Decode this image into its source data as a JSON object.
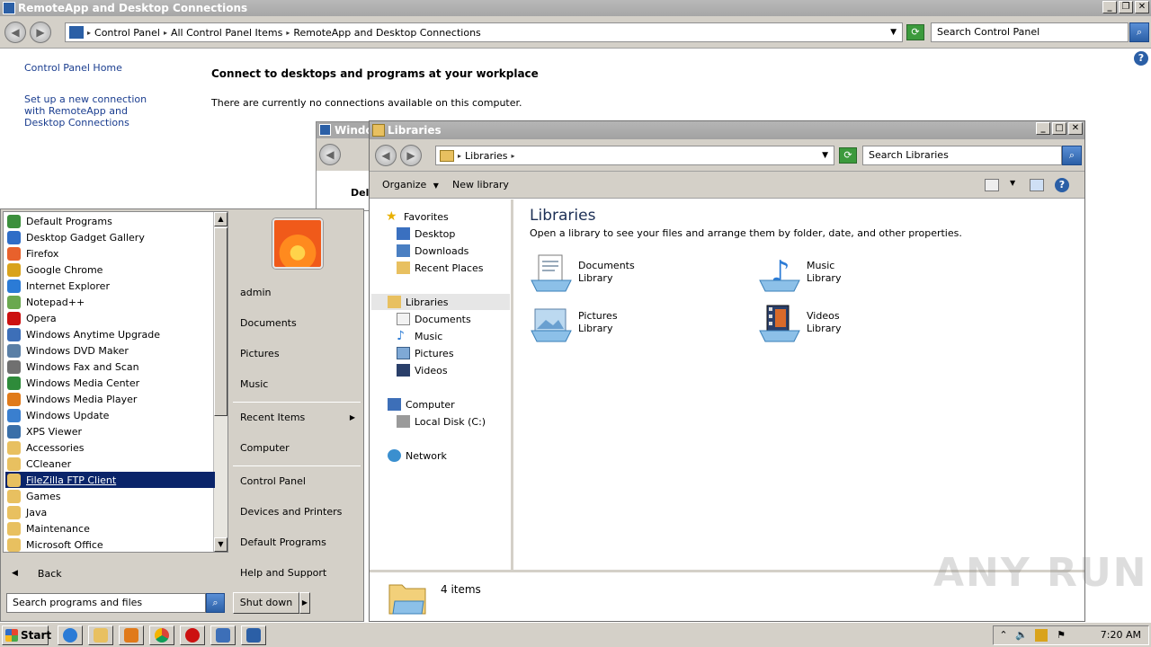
{
  "control_panel": {
    "title": "RemoteApp and Desktop Connections",
    "breadcrumbs": [
      "Control Panel",
      "All Control Panel Items",
      "RemoteApp and Desktop Connections"
    ],
    "search_placeholder": "Search Control Panel",
    "links": {
      "home": "Control Panel Home",
      "setup": "Set up a new connection with RemoteApp and Desktop Connections"
    },
    "heading": "Connect to desktops and programs at your workplace",
    "message": "There are currently no connections available on this computer."
  },
  "mid_window": {
    "title": "Windo",
    "partial_text": "Del"
  },
  "libraries": {
    "title": "Libraries",
    "breadcrumb": "Libraries",
    "search_placeholder": "Search Libraries",
    "toolbar": {
      "organize": "Organize",
      "new_library": "New library"
    },
    "nav": {
      "favorites": "Favorites",
      "desktop": "Desktop",
      "downloads": "Downloads",
      "recent_places": "Recent Places",
      "libraries": "Libraries",
      "documents": "Documents",
      "music": "Music",
      "pictures": "Pictures",
      "videos": "Videos",
      "computer": "Computer",
      "local_disk": "Local Disk (C:)",
      "network": "Network"
    },
    "content_title": "Libraries",
    "content_desc": "Open a library to see your files and arrange them by folder, date, and other properties.",
    "items": [
      {
        "name": "Documents",
        "type": "Library",
        "icon": "documents-library-icon"
      },
      {
        "name": "Music",
        "type": "Library",
        "icon": "music-library-icon"
      },
      {
        "name": "Pictures",
        "type": "Library",
        "icon": "pictures-library-icon"
      },
      {
        "name": "Videos",
        "type": "Library",
        "icon": "videos-library-icon"
      }
    ],
    "item_count": "4 items"
  },
  "start_menu": {
    "programs": [
      {
        "label": "Default Programs",
        "color": "#3c8f3c"
      },
      {
        "label": "Desktop Gadget Gallery",
        "color": "#2f6dc7"
      },
      {
        "label": "Firefox",
        "color": "#e8612c"
      },
      {
        "label": "Google Chrome",
        "color": "#d9a31c"
      },
      {
        "label": "Internet Explorer",
        "color": "#2b7bd6"
      },
      {
        "label": "Notepad++",
        "color": "#6aa84f"
      },
      {
        "label": "Opera",
        "color": "#cc1010"
      },
      {
        "label": "Windows Anytime Upgrade",
        "color": "#3d6fb8"
      },
      {
        "label": "Windows DVD Maker",
        "color": "#5a7fa6"
      },
      {
        "label": "Windows Fax and Scan",
        "color": "#707070"
      },
      {
        "label": "Windows Media Center",
        "color": "#2e8b3a"
      },
      {
        "label": "Windows Media Player",
        "color": "#e07a1a"
      },
      {
        "label": "Windows Update",
        "color": "#3a7fcf"
      },
      {
        "label": "XPS Viewer",
        "color": "#3a6fa8"
      },
      {
        "label": "Accessories",
        "color": "#e8c060"
      },
      {
        "label": "CCleaner",
        "color": "#e8c060"
      },
      {
        "label": "FileZilla FTP Client",
        "color": "#e8c060",
        "highlight": true
      },
      {
        "label": "Games",
        "color": "#e8c060"
      },
      {
        "label": "Java",
        "color": "#e8c060"
      },
      {
        "label": "Maintenance",
        "color": "#e8c060"
      },
      {
        "label": "Microsoft Office",
        "color": "#e8c060"
      }
    ],
    "back_label": "Back",
    "search_placeholder": "Search programs and files",
    "user": "admin",
    "right_items": {
      "documents": "Documents",
      "pictures": "Pictures",
      "music": "Music",
      "recent_items": "Recent Items",
      "computer": "Computer",
      "control_panel": "Control Panel",
      "devices_printers": "Devices and Printers",
      "default_programs": "Default Programs",
      "help_support": "Help and Support"
    },
    "shutdown": "Shut down"
  },
  "taskbar": {
    "start_label": "Start",
    "clock": "7:20 AM"
  },
  "watermark": "ANY RUN"
}
